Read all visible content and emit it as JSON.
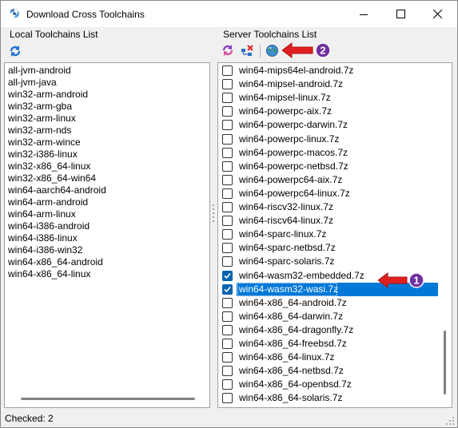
{
  "window": {
    "title": "Download Cross Toolchains"
  },
  "left_pane": {
    "label": "Local Toolchains List",
    "items": [
      "all-jvm-android",
      "all-jvm-java",
      "win32-arm-android",
      "win32-arm-gba",
      "win32-arm-linux",
      "win32-arm-nds",
      "win32-arm-wince",
      "win32-i386-linux",
      "win32-x86_64-linux",
      "win32-x86_64-win64",
      "win64-aarch64-android",
      "win64-arm-android",
      "win64-arm-linux",
      "win64-i386-android",
      "win64-i386-linux",
      "win64-i386-win32",
      "win64-x86_64-android",
      "win64-x86_64-linux"
    ]
  },
  "right_pane": {
    "label": "Server Toolchains List",
    "items": [
      {
        "label": "win64-mips64el-android.7z",
        "checked": false,
        "selected": false
      },
      {
        "label": "win64-mipsel-android.7z",
        "checked": false,
        "selected": false
      },
      {
        "label": "win64-mipsel-linux.7z",
        "checked": false,
        "selected": false
      },
      {
        "label": "win64-powerpc-aix.7z",
        "checked": false,
        "selected": false
      },
      {
        "label": "win64-powerpc-darwin.7z",
        "checked": false,
        "selected": false
      },
      {
        "label": "win64-powerpc-linux.7z",
        "checked": false,
        "selected": false
      },
      {
        "label": "win64-powerpc-macos.7z",
        "checked": false,
        "selected": false
      },
      {
        "label": "win64-powerpc-netbsd.7z",
        "checked": false,
        "selected": false
      },
      {
        "label": "win64-powerpc64-aix.7z",
        "checked": false,
        "selected": false
      },
      {
        "label": "win64-powerpc64-linux.7z",
        "checked": false,
        "selected": false
      },
      {
        "label": "win64-riscv32-linux.7z",
        "checked": false,
        "selected": false
      },
      {
        "label": "win64-riscv64-linux.7z",
        "checked": false,
        "selected": false
      },
      {
        "label": "win64-sparc-linux.7z",
        "checked": false,
        "selected": false
      },
      {
        "label": "win64-sparc-netbsd.7z",
        "checked": false,
        "selected": false
      },
      {
        "label": "win64-sparc-solaris.7z",
        "checked": false,
        "selected": false
      },
      {
        "label": "win64-wasm32-embedded.7z",
        "checked": true,
        "selected": false
      },
      {
        "label": "win64-wasm32-wasi.7z",
        "checked": true,
        "selected": true
      },
      {
        "label": "win64-x86_64-android.7z",
        "checked": false,
        "selected": false
      },
      {
        "label": "win64-x86_64-darwin.7z",
        "checked": false,
        "selected": false
      },
      {
        "label": "win64-x86_64-dragonfly.7z",
        "checked": false,
        "selected": false
      },
      {
        "label": "win64-x86_64-freebsd.7z",
        "checked": false,
        "selected": false
      },
      {
        "label": "win64-x86_64-linux.7z",
        "checked": false,
        "selected": false
      },
      {
        "label": "win64-x86_64-netbsd.7z",
        "checked": false,
        "selected": false
      },
      {
        "label": "win64-x86_64-openbsd.7z",
        "checked": false,
        "selected": false
      },
      {
        "label": "win64-x86_64-solaris.7z",
        "checked": false,
        "selected": false
      }
    ]
  },
  "status": {
    "checked_text": "Checked: 2"
  },
  "callouts": [
    {
      "number": "1",
      "target": "win64-wasm32-wasi.7z"
    },
    {
      "number": "2",
      "target": "download-button"
    }
  ],
  "colors": {
    "selection": "#0078d7",
    "checkbox_checked": "#0063b1",
    "callout_arrow": "#e02020",
    "callout_badge": "#7030a0"
  },
  "icons": [
    "app-logo-icon",
    "minimize-icon",
    "maximize-icon",
    "close-icon",
    "refresh-icon",
    "reload-server-icon",
    "tree-select-icon",
    "globe-download-icon",
    "size-grip-icon"
  ]
}
